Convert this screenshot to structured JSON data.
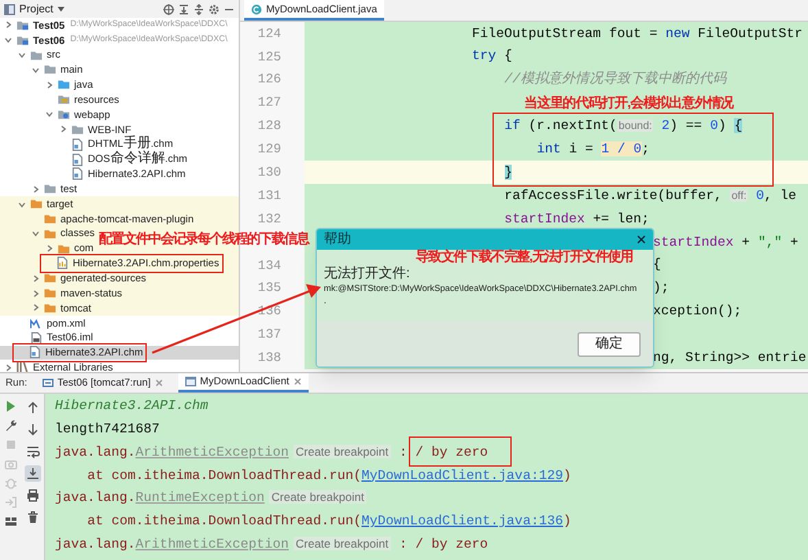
{
  "project_panel": {
    "title": "Project",
    "tree": [
      {
        "label": "Test05",
        "kind": "module",
        "path": "D:\\MyWorkSpace\\IdeaWorkSpace\\DDXC\\",
        "expanded": false,
        "selected": false
      },
      {
        "label": "Test06",
        "kind": "module",
        "path": "D:\\MyWorkSpace\\IdeaWorkSpace\\DDXC\\",
        "expanded": true,
        "selected": false,
        "children": [
          {
            "label": "src",
            "kind": "folder",
            "expanded": true,
            "selected": false,
            "children": [
              {
                "label": "main",
                "kind": "folder",
                "expanded": true,
                "selected": false,
                "children": [
                  {
                    "label": "java",
                    "kind": "source",
                    "expanded": false,
                    "selected": false
                  },
                  {
                    "label": "resources",
                    "kind": "resources",
                    "selected": false
                  },
                  {
                    "label": "webapp",
                    "kind": "web",
                    "expanded": true,
                    "selected": false,
                    "children": [
                      {
                        "label": "WEB-INF",
                        "kind": "folder",
                        "expanded": false,
                        "selected": false
                      },
                      {
                        "label": "DHTML手册.chm",
                        "kind": "chm",
                        "selected": false
                      },
                      {
                        "label": "DOS命令详解.chm",
                        "kind": "chm",
                        "selected": false
                      },
                      {
                        "label": "Hibernate3.2API.chm",
                        "kind": "chm",
                        "selected": false
                      }
                    ]
                  }
                ]
              },
              {
                "label": "test",
                "kind": "folder",
                "expanded": false,
                "selected": false
              }
            ]
          },
          {
            "label": "target",
            "kind": "excluded",
            "expanded": true,
            "excluded": true,
            "selected": false,
            "children": [
              {
                "label": "apache-tomcat-maven-plugin",
                "kind": "excluded",
                "selected": false
              },
              {
                "label": "classes",
                "kind": "excluded",
                "expanded": true,
                "selected": false,
                "children": [
                  {
                    "label": "com",
                    "kind": "excluded",
                    "expanded": false,
                    "selected": false
                  },
                  {
                    "label": "Hibernate3.2API.chm.properties",
                    "kind": "properties",
                    "selected": false
                  }
                ]
              },
              {
                "label": "generated-sources",
                "kind": "excluded",
                "expanded": false,
                "selected": false
              },
              {
                "label": "maven-status",
                "kind": "excluded",
                "expanded": false,
                "selected": false
              },
              {
                "label": "tomcat",
                "kind": "excluded",
                "expanded": false,
                "selected": false
              }
            ]
          },
          {
            "label": "pom.xml",
            "kind": "maven",
            "selected": false
          },
          {
            "label": "Test06.iml",
            "kind": "iml",
            "selected": false
          },
          {
            "label": "Hibernate3.2API.chm",
            "kind": "chm",
            "selected": true
          }
        ]
      },
      {
        "label": "External Libraries",
        "kind": "library",
        "expanded": false,
        "selected": false
      }
    ]
  },
  "editor": {
    "tabs": [
      {
        "label": "MyDownLoadClient.java",
        "selected": true
      }
    ],
    "lines": [
      {
        "number": "124",
        "current": false,
        "segments": [
          {
            "text": "                    FileOutputStream fout = ",
            "kind": "plain"
          },
          {
            "text": "new",
            "kind": "keyword"
          },
          {
            "text": " FileOutputStr",
            "kind": "plain"
          }
        ]
      },
      {
        "number": "125",
        "current": false,
        "segments": [
          {
            "text": "                    try",
            "kind": "keyword"
          },
          {
            "text": " {",
            "kind": "plain"
          }
        ]
      },
      {
        "number": "126",
        "current": false,
        "segments": [
          {
            "text": "                        //模拟意外情况导致下载中断的代码",
            "kind": "comment"
          }
        ]
      },
      {
        "number": "127",
        "current": false
      },
      {
        "number": "128",
        "current": false,
        "segments": [
          {
            "text": "                        if",
            "kind": "keyword"
          },
          {
            "text": " (r.nextInt(",
            "kind": "plain"
          },
          {
            "text": "bound:",
            "kind": "hint"
          },
          {
            "text": " 2",
            "kind": "number"
          },
          {
            "text": ") == ",
            "kind": "plain"
          },
          {
            "text": "0",
            "kind": "number"
          },
          {
            "text": ") ",
            "kind": "plain"
          },
          {
            "text": "{",
            "kind": "bracket"
          }
        ]
      },
      {
        "number": "129",
        "current": false,
        "segments": [
          {
            "text": "                            int",
            "kind": "keyword"
          },
          {
            "text": " i = ",
            "kind": "plain"
          },
          {
            "text": "1 / 0",
            "kind": "warning"
          },
          {
            "text": ";",
            "kind": "plain"
          }
        ]
      },
      {
        "number": "130",
        "current": true,
        "segments": [
          {
            "text": "                        }",
            "kind": "bracket"
          }
        ]
      },
      {
        "number": "131",
        "current": false,
        "segments": [
          {
            "text": "                        rafAccessFile.write(buffer, ",
            "kind": "plain"
          },
          {
            "text": "off:",
            "kind": "hint"
          },
          {
            "text": " 0",
            "kind": "number"
          },
          {
            "text": ", le",
            "kind": "plain"
          }
        ]
      },
      {
        "number": "132",
        "current": false,
        "segments": [
          {
            "text": "                        startIndex",
            "kind": "field"
          },
          {
            "text": " += len;",
            "kind": "plain"
          }
        ]
      },
      {
        "current": false,
        "clipped": true,
        "segments": [
          {
            "text": "startIndex",
            "kind": "field"
          },
          {
            "text": " + ",
            "kind": "plain"
          },
          {
            "text": "\",\"",
            "kind": "string"
          },
          {
            "text": " +",
            "kind": "plain"
          }
        ]
      },
      {
        "number": "134",
        "current": false,
        "clipped": true,
        "segments": [
          {
            "text": "{",
            "kind": "plain"
          }
        ]
      },
      {
        "number": "135",
        "current": false,
        "clipped": true,
        "segments": [
          {
            "text": ");",
            "kind": "plain"
          }
        ]
      },
      {
        "number": "136",
        "current": false,
        "clipped": true,
        "segments": [
          {
            "text": "xception();",
            "kind": "plain"
          }
        ]
      },
      {
        "number": "137",
        "current": false
      },
      {
        "number": "138",
        "current": false,
        "clipped": true,
        "segments": [
          {
            "text": "ng, String>> entrie",
            "kind": "plain"
          }
        ]
      }
    ]
  },
  "dialog": {
    "title": "帮助",
    "message": "无法打开文件:",
    "path": "mk:@MSITStore:D:\\MyWorkSpace\\IdeaWorkSpace\\DDXC\\Hibernate3.2API.chm",
    "trailer": ".",
    "button": "确定"
  },
  "run_panel": {
    "label": "Run:",
    "tabs": [
      {
        "label": "Test06 [tomcat7:run]",
        "selected": false
      },
      {
        "label": "MyDownLoadClient",
        "selected": true
      }
    ],
    "main_toolbar": [
      {
        "disabled": false
      },
      {
        "disabled": false
      },
      {
        "disabled": true
      },
      {
        "disabled": true
      },
      {
        "disabled": true
      },
      {
        "disabled": true
      },
      {
        "disabled": false
      }
    ],
    "secondary_toolbar": [
      {
        "pressed": false
      },
      {
        "pressed": false
      },
      {
        "pressed": false
      },
      {
        "pressed": true
      },
      {
        "pressed": false
      },
      {
        "pressed": false
      }
    ],
    "output": [
      {
        "segments": [
          {
            "text": "Hibernate3.2API.chm",
            "kind": "italic"
          }
        ]
      },
      {
        "segments": [
          {
            "text": "length7421687",
            "kind": "plain"
          }
        ]
      },
      {
        "segments": [
          {
            "text": "java.lang.",
            "kind": "error"
          },
          {
            "text": "ArithmeticException",
            "kind": "exception"
          },
          {
            "text": "Create breakpoint",
            "kind": "hint"
          },
          {
            "text": " : / by zero",
            "kind": "error"
          }
        ]
      },
      {
        "segments": [
          {
            "text": "    at com.itheima.DownloadThread.run(",
            "kind": "error"
          },
          {
            "text": "MyDownLoadClient.java:129",
            "kind": "link"
          },
          {
            "text": ")",
            "kind": "error"
          }
        ]
      },
      {
        "segments": [
          {
            "text": "java.lang.",
            "kind": "error"
          },
          {
            "text": "RuntimeException",
            "kind": "exception"
          },
          {
            "text": "Create breakpoint",
            "kind": "hint"
          }
        ]
      },
      {
        "segments": [
          {
            "text": "    at com.itheima.DownloadThread.run(",
            "kind": "error"
          },
          {
            "text": "MyDownLoadClient.java:136",
            "kind": "link"
          },
          {
            "text": ")",
            "kind": "error"
          }
        ]
      },
      {
        "segments": [
          {
            "text": "java.lang.",
            "kind": "error"
          },
          {
            "text": "ArithmeticException",
            "kind": "exception"
          },
          {
            "text": "Create breakpoint",
            "kind": "hint"
          },
          {
            "text": " : / by zero",
            "kind": "error"
          }
        ]
      }
    ]
  },
  "annotations": [
    {
      "text": "当这里的代码打开,会模拟出意外情况"
    },
    {
      "text": "配置文件中会记录每个线程的下载信息"
    },
    {
      "text": "导致文件下载不完整,无法打开文件使用"
    }
  ]
}
